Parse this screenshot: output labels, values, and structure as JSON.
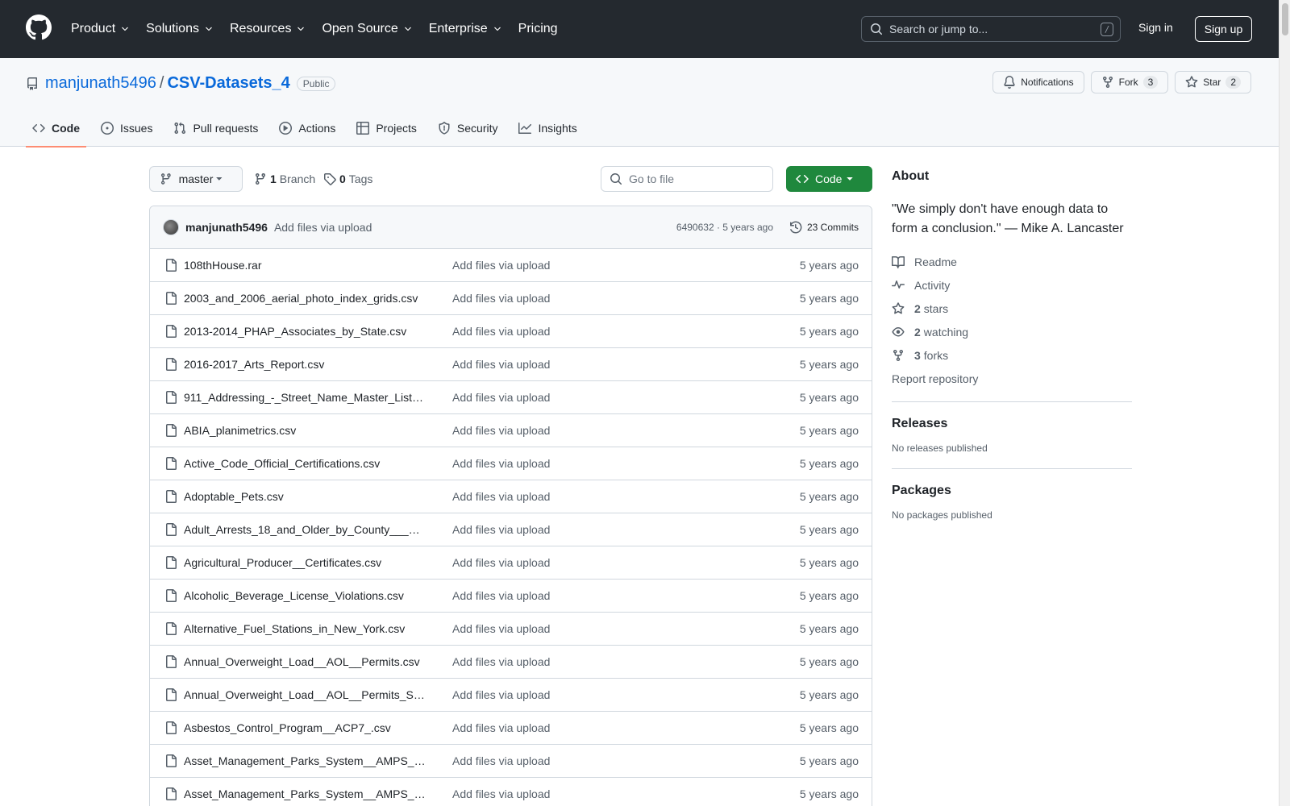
{
  "header": {
    "nav": [
      {
        "label": "Product",
        "has_menu": true
      },
      {
        "label": "Solutions",
        "has_menu": true
      },
      {
        "label": "Resources",
        "has_menu": true
      },
      {
        "label": "Open Source",
        "has_menu": true
      },
      {
        "label": "Enterprise",
        "has_menu": true
      },
      {
        "label": "Pricing",
        "has_menu": false
      }
    ],
    "search_placeholder": "Search or jump to...",
    "search_shortcut": "/",
    "signin": "Sign in",
    "signup": "Sign up"
  },
  "repo": {
    "owner": "manjunath5496",
    "separator": "/",
    "name": "CSV-Datasets_4",
    "visibility": "Public",
    "notifications": "Notifications",
    "fork": "Fork",
    "fork_count": "3",
    "star": "Star",
    "star_count": "2",
    "tabs": [
      {
        "label": "Code",
        "icon": "code-icon",
        "active": true
      },
      {
        "label": "Issues",
        "icon": "issue-icon",
        "active": false
      },
      {
        "label": "Pull requests",
        "icon": "pull-request-icon",
        "active": false
      },
      {
        "label": "Actions",
        "icon": "play-icon",
        "active": false
      },
      {
        "label": "Projects",
        "icon": "table-icon",
        "active": false
      },
      {
        "label": "Security",
        "icon": "shield-icon",
        "active": false
      },
      {
        "label": "Insights",
        "icon": "graph-icon",
        "active": false
      }
    ]
  },
  "toolbar": {
    "branch": "master",
    "branch_count": "1",
    "branch_label": "Branch",
    "tag_count": "0",
    "tag_label": "Tags",
    "goto_placeholder": "Go to file",
    "code_button": "Code"
  },
  "commit": {
    "author": "manjunath5496",
    "message": "Add files via upload",
    "meta": "6490632 · 5 years ago",
    "commits": "23 Commits"
  },
  "files": [
    {
      "name": "108thHouse.rar",
      "message": "Add files via upload",
      "date": "5 years ago"
    },
    {
      "name": "2003_and_2006_aerial_photo_index_grids.csv",
      "message": "Add files via upload",
      "date": "5 years ago"
    },
    {
      "name": "2013-2014_PHAP_Associates_by_State.csv",
      "message": "Add files via upload",
      "date": "5 years ago"
    },
    {
      "name": "2016-2017_Arts_Report.csv",
      "message": "Add files via upload",
      "date": "5 years ago"
    },
    {
      "name": "911_Addressing_-_Street_Name_Master_List…",
      "message": "Add files via upload",
      "date": "5 years ago"
    },
    {
      "name": "ABIA_planimetrics.csv",
      "message": "Add files via upload",
      "date": "5 years ago"
    },
    {
      "name": "Active_Code_Official_Certifications.csv",
      "message": "Add files via upload",
      "date": "5 years ago"
    },
    {
      "name": "Adoptable_Pets.csv",
      "message": "Add files via upload",
      "date": "5 years ago"
    },
    {
      "name": "Adult_Arrests_18_and_Older_by_County___…",
      "message": "Add files via upload",
      "date": "5 years ago"
    },
    {
      "name": "Agricultural_Producer__Certificates.csv",
      "message": "Add files via upload",
      "date": "5 years ago"
    },
    {
      "name": "Alcoholic_Beverage_License_Violations.csv",
      "message": "Add files via upload",
      "date": "5 years ago"
    },
    {
      "name": "Alternative_Fuel_Stations_in_New_York.csv",
      "message": "Add files via upload",
      "date": "5 years ago"
    },
    {
      "name": "Annual_Overweight_Load__AOL__Permits.csv",
      "message": "Add files via upload",
      "date": "5 years ago"
    },
    {
      "name": "Annual_Overweight_Load__AOL__Permits_S…",
      "message": "Add files via upload",
      "date": "5 years ago"
    },
    {
      "name": "Asbestos_Control_Program__ACP7_.csv",
      "message": "Add files via upload",
      "date": "5 years ago"
    },
    {
      "name": "Asset_Management_Parks_System__AMPS_…",
      "message": "Add files via upload",
      "date": "5 years ago"
    },
    {
      "name": "Asset_Management_Parks_System__AMPS_…",
      "message": "Add files via upload",
      "date": "5 years ago"
    }
  ],
  "sidebar": {
    "about_title": "About",
    "description": "\"We simply don't have enough data to form a conclusion.\" — Mike A. Lancaster",
    "readme": "Readme",
    "activity": "Activity",
    "stars_count": "2",
    "stars_label": "stars",
    "watching_count": "2",
    "watching_label": "watching",
    "forks_count": "3",
    "forks_label": "forks",
    "report": "Report repository",
    "releases_title": "Releases",
    "releases_sub": "No releases published",
    "packages_title": "Packages",
    "packages_sub": "No packages published"
  },
  "colors": {
    "header_bg": "#24292f",
    "link": "#0969da",
    "code_button": "#1f883d",
    "active_tab_underline": "#fd8c73"
  }
}
